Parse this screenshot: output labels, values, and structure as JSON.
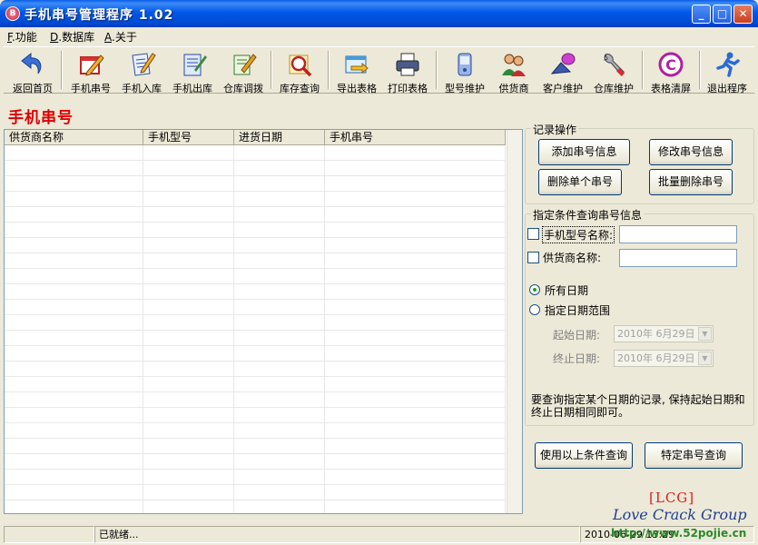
{
  "window": {
    "title": "手机串号管理程序 1.02",
    "icon_letter": "B",
    "controls": [
      "_",
      "□",
      "✕"
    ]
  },
  "menu": [
    {
      "key": "F",
      "label": ".功能"
    },
    {
      "key": "D",
      "label": ".数据库"
    },
    {
      "key": "A",
      "label": ".关于"
    }
  ],
  "toolbar": [
    {
      "label": "返回首页",
      "icon": "back-arrow-icon"
    },
    {
      "label": "手机串号",
      "icon": "notebook-pencil-icon"
    },
    {
      "label": "手机入库",
      "icon": "document-pencil-icon"
    },
    {
      "label": "手机出库",
      "icon": "document-out-icon"
    },
    {
      "label": "仓库调拨",
      "icon": "transfer-icon"
    },
    {
      "label": "库存查询",
      "icon": "magnifier-icon"
    },
    {
      "label": "导出表格",
      "icon": "export-icon"
    },
    {
      "label": "打印表格",
      "icon": "printer-icon"
    },
    {
      "label": "型号维护",
      "icon": "phone-model-icon"
    },
    {
      "label": "供货商",
      "icon": "supplier-people-icon"
    },
    {
      "label": "客户维护",
      "icon": "customer-icon"
    },
    {
      "label": "仓库维护",
      "icon": "wrench-icon"
    },
    {
      "label": "表格清屏",
      "icon": "clear-icon"
    },
    {
      "label": "退出程序",
      "icon": "exit-runner-icon"
    }
  ],
  "page": {
    "heading": "手机串号"
  },
  "grid": {
    "columns": [
      "供货商名称",
      "手机型号",
      "进货日期",
      "手机串号"
    ],
    "rows": []
  },
  "record_ops": {
    "legend": "记录操作",
    "add": "添加串号信息",
    "edit": "修改串号信息",
    "delete_one": "删除单个串号",
    "delete_batch": "批量删除串号"
  },
  "query": {
    "legend": "指定条件查询串号信息",
    "model_label": "手机型号名称:",
    "model_value": "",
    "supplier_label": "供货商名称:",
    "supplier_value": "",
    "all_dates": "所有日期",
    "date_range": "指定日期范围",
    "start_label": "起始日期:",
    "start_value": "2010年  6月29日",
    "end_label": "终止日期:",
    "end_value": "2010年  6月29日",
    "hint": "要查询指定某个日期的记录, 保持起始日期和终止日期相同即可。",
    "btn_query": "使用以上条件查询",
    "btn_specific": "特定串号查询"
  },
  "watermark": {
    "lcg": "[LCG]",
    "love": "Love Crack Group",
    "url": "http://www.52pojie.cn"
  },
  "status": {
    "left": "",
    "middle": "已就绪...",
    "right": "2010-06-29 13:29"
  },
  "colors": {
    "heading": "#e00000",
    "titlebar": "#0058e6",
    "face": "#ece9d8"
  }
}
